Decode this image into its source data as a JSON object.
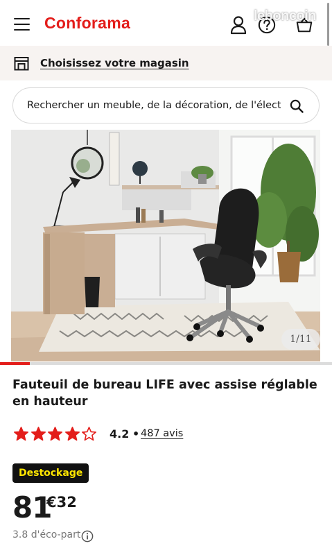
{
  "header": {
    "logo": "Conforama",
    "watermark": "leboncoin",
    "icons": [
      "menu-icon",
      "user-icon",
      "help-icon",
      "cart-icon"
    ]
  },
  "store_bar": {
    "label": "Choisissez votre magasin",
    "icon": "store-icon"
  },
  "search": {
    "placeholder": "Rechercher un meuble, de la décoration, de l'électroménager",
    "icon": "search-icon"
  },
  "gallery": {
    "counter": "1/11",
    "current": 1,
    "total": 11,
    "progress": 0.09
  },
  "product": {
    "title": "Fauteuil de bureau LIFE avec assise réglable en hauteur",
    "rating_value": "4.2",
    "rating_stars": 4.2,
    "rating_separator": "•",
    "reviews": "487 avis",
    "badge": "Destockage",
    "price_int": "81",
    "price_cents": "€32",
    "eco_part": "3.8 d'éco-part"
  },
  "colors": {
    "brand": "#e31d1a",
    "badge_bg": "#111111",
    "badge_text": "#ffe600",
    "store_bar_bg": "#f7f3f1"
  }
}
